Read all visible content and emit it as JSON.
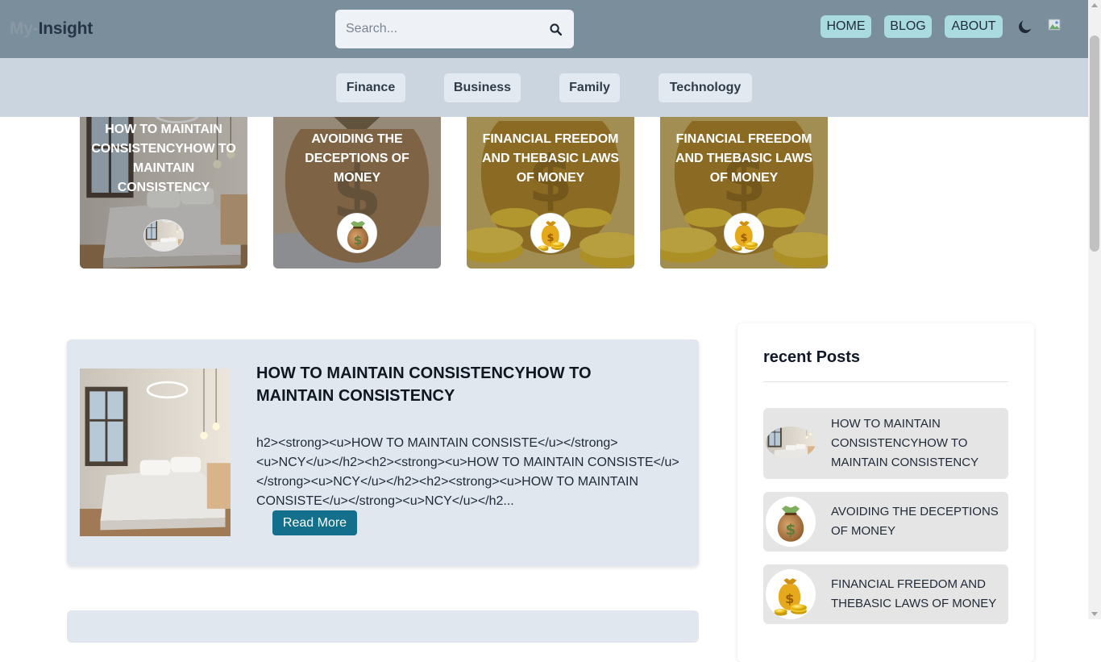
{
  "header": {
    "brand_part1": "My-",
    "brand_part2": "Insight",
    "search_placeholder": "Search...",
    "nav": [
      {
        "label": "HOME"
      },
      {
        "label": "BLOG"
      },
      {
        "label": "ABOUT"
      }
    ]
  },
  "categories": [
    "Finance",
    "Business",
    "Family",
    "Technology"
  ],
  "featured": [
    {
      "title": "HOW TO MAINTAIN CONSISTENCYHOW TO MAINTAIN CONSISTENCY",
      "image": "bedroom"
    },
    {
      "title": "AVOIDING THE DECEPTIONS OF MONEY",
      "image": "money-bag"
    },
    {
      "title": "FINANCIAL FREEDOM AND THEBASIC LAWS OF MONEY",
      "image": "gold-coins"
    },
    {
      "title": "FINANCIAL FREEDOM AND THEBASIC LAWS OF MONEY",
      "image": "gold-coins"
    }
  ],
  "post": {
    "title": "HOW TO MAINTAIN CONSISTENCYHOW TO MAINTAIN CONSISTENCY",
    "excerpt": "h2><strong><u>HOW TO MAINTAIN CONSISTE</u></strong><u>NCY</u></h2><h2><strong><u>HOW TO MAINTAIN CONSISTE</u></strong><u>NCY</u></h2><h2><strong><u>HOW TO MAINTAIN CONSISTE</u></strong><u>NCY</u></h2...",
    "read_more": "Read More"
  },
  "sidebar": {
    "heading": "recent Posts",
    "items": [
      {
        "title": "HOW TO MAINTAIN CONSISTENCYHOW TO MAINTAIN CONSISTENCY"
      },
      {
        "title": "AVOIDING THE DECEPTIONS OF MONEY"
      },
      {
        "title": "FINANCIAL FREEDOM AND THEBASIC LAWS OF MONEY"
      }
    ]
  },
  "colors": {
    "header_bg": "#7a8f9b",
    "category_bar_bg": "#cbd5df",
    "nav_button_bg": "#a9dbe0",
    "accent_button": "#136f8b",
    "post_card_bg": "#e1e7ef"
  },
  "icons": [
    "search-icon",
    "moon-icon",
    "avatar"
  ]
}
